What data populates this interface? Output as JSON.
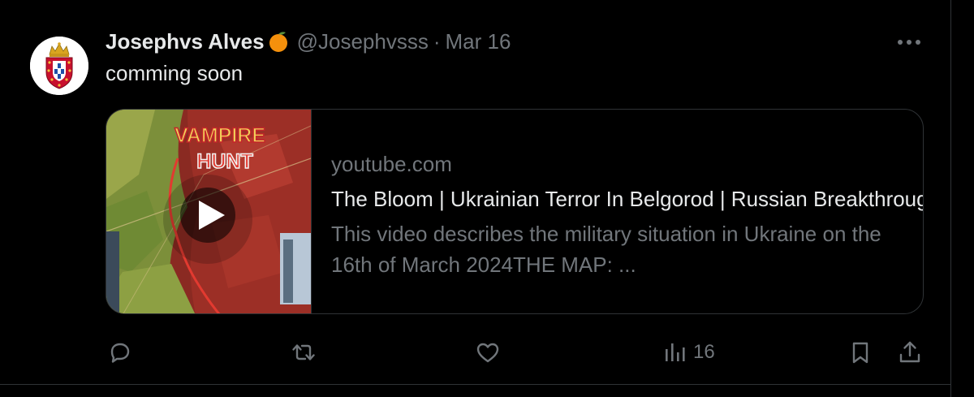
{
  "tweet": {
    "author": {
      "display_name": "Josephvs Alves",
      "name_emoji": "orange-emoji",
      "handle": "@Josephvsss",
      "avatar": "portuguese-royal-coat-of-arms"
    },
    "separator": "·",
    "date": "Mar 16",
    "text": "comming soon",
    "more_icon": "more-horizontal-icon",
    "card": {
      "thumbnail": {
        "title_line1": "VAMPIRE",
        "title_line2": "HUNT",
        "play_icon": "play-icon"
      },
      "domain": "youtube.com",
      "title": "The Bloom | Ukrainian Terror In Belgorod | Russian Breakthrough In Orlovka | Military Summary",
      "description": "This video describes the military situation in Ukraine on the 16th of March 2024THE MAP: ..."
    },
    "actions": {
      "reply_icon": "reply-icon",
      "retweet_icon": "retweet-icon",
      "like_icon": "heart-icon",
      "views_icon": "views-chart-icon",
      "views_count": "16",
      "bookmark_icon": "bookmark-icon",
      "share_icon": "share-icon"
    }
  },
  "colors": {
    "background": "#000000",
    "primary_text": "#e7e9ea",
    "secondary_text": "#71767b",
    "border": "#2f3336"
  }
}
